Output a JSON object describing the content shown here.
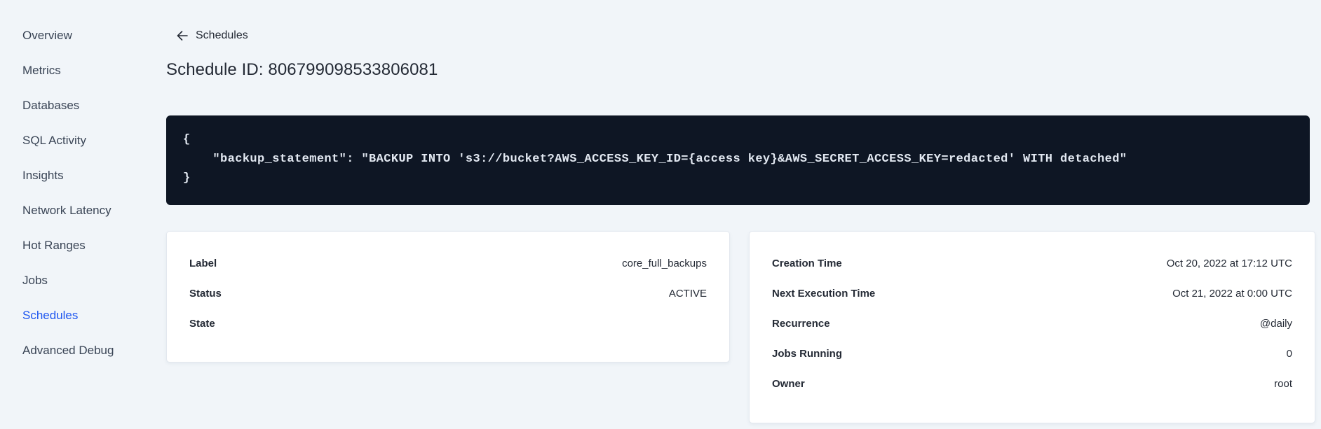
{
  "colors": {
    "accent_blue": "#1E56F0",
    "code_background": "#0E1624",
    "page_background": "#F1F5F9",
    "text_dark": "#242A35",
    "sidebar_text": "#394455"
  },
  "sidebar": {
    "items": [
      {
        "label": "Overview",
        "active": false
      },
      {
        "label": "Metrics",
        "active": false
      },
      {
        "label": "Databases",
        "active": false
      },
      {
        "label": "SQL Activity",
        "active": false
      },
      {
        "label": "Insights",
        "active": false
      },
      {
        "label": "Network Latency",
        "active": false
      },
      {
        "label": "Hot Ranges",
        "active": false
      },
      {
        "label": "Jobs",
        "active": false
      },
      {
        "label": "Schedules",
        "active": true
      },
      {
        "label": "Advanced Debug",
        "active": false
      }
    ]
  },
  "page": {
    "back_label": "Schedules",
    "back_icon": "arrow-left-icon",
    "title": "Schedule ID: 806799098533806081"
  },
  "code_block": {
    "lines": [
      "{",
      "    \"backup_statement\": \"BACKUP INTO 's3://bucket?AWS_ACCESS_KEY_ID={access key}&AWS_SECRET_ACCESS_KEY=redacted' WITH detached\"",
      "}"
    ]
  },
  "schedule_card": {
    "rows": [
      {
        "label": "Label",
        "value": "core_full_backups"
      },
      {
        "label": "Status",
        "value": "ACTIVE"
      },
      {
        "label": "State",
        "value": ""
      }
    ]
  },
  "execution_card": {
    "rows": [
      {
        "label": "Creation Time",
        "value": "Oct 20, 2022 at 17:12 UTC"
      },
      {
        "label": "Next Execution Time",
        "value": "Oct 21, 2022 at 0:00 UTC"
      },
      {
        "label": "Recurrence",
        "value": "@daily"
      },
      {
        "label": "Jobs Running",
        "value": "0"
      },
      {
        "label": "Owner",
        "value": "root"
      }
    ]
  }
}
